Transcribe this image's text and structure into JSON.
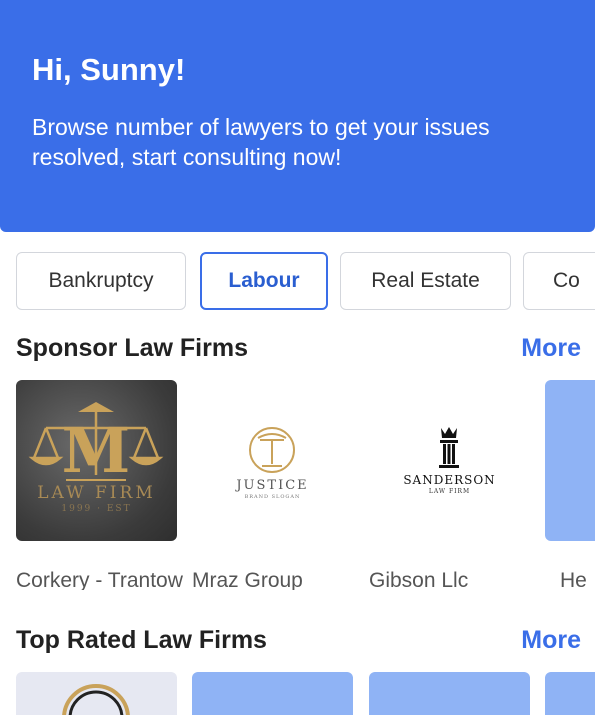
{
  "header": {
    "greeting": "Hi, Sunny!",
    "subtitle": "Browse number of lawyers to get your issues resolved, start consulting now!",
    "background_color": "#3a6ee8"
  },
  "categories": [
    {
      "label": "Bankruptcy",
      "selected": false
    },
    {
      "label": "Labour",
      "selected": true
    },
    {
      "label": "Real Estate",
      "selected": false
    },
    {
      "label": "Co",
      "selected": false
    }
  ],
  "sponsor_section": {
    "title": "Sponsor Law Firms",
    "more_label": "More",
    "firms": [
      {
        "name": "Corkery - Trantow",
        "logo_text": "LAW FIRM",
        "logo_subtext": "1999 · EST",
        "logo_icon": "scales-of-justice-icon"
      },
      {
        "name": "Mraz Group",
        "logo_text": "JUSTICE",
        "logo_subtext": "BRAND SLOGAN",
        "logo_icon": "pillar-icon"
      },
      {
        "name": "Gibson Llc",
        "logo_text": "SANDERSON",
        "logo_subtext": "LAW FIRM",
        "logo_icon": "crown-pillar-icon"
      },
      {
        "name": "He",
        "logo_text": "",
        "logo_subtext": "",
        "logo_icon": "image-placeholder"
      }
    ]
  },
  "top_rated_section": {
    "title": "Top Rated Law Firms",
    "more_label": "More"
  },
  "colors": {
    "accent": "#3a6ee8",
    "placeholder": "#8fb3f5",
    "gold": "#c9a25a"
  }
}
